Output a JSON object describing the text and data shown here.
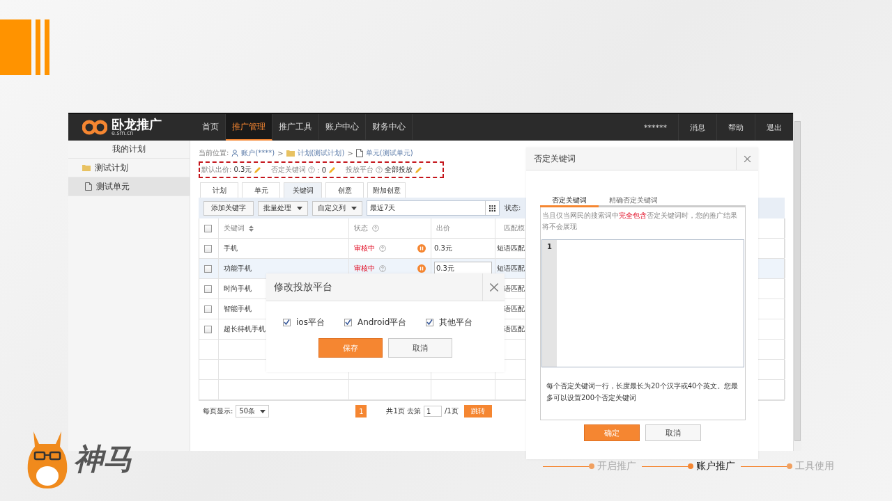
{
  "slide": {
    "steps": [
      {
        "label": "开启推广",
        "selected": false
      },
      {
        "label": "账户推广",
        "selected": true
      },
      {
        "label": "工具使用",
        "selected": false
      }
    ],
    "brand": "神马"
  },
  "app": {
    "logo": "卧龙推广",
    "logo_sub": "e.sm.cn",
    "nav": [
      {
        "label": "首页",
        "selected": false
      },
      {
        "label": "推广管理",
        "selected": true
      },
      {
        "label": "推广工具",
        "selected": false
      },
      {
        "label": "账户中心",
        "selected": false
      },
      {
        "label": "财务中心",
        "selected": false
      }
    ],
    "user": "******",
    "links": [
      "消息",
      "帮助",
      "退出"
    ]
  },
  "sidebar": {
    "title": "我的计划",
    "items": [
      {
        "label": "测试计划",
        "kind": "folder",
        "selected": false,
        "children": [
          {
            "label": "测试单元",
            "kind": "file",
            "selected": true
          }
        ]
      }
    ]
  },
  "breadcrumb": {
    "label": "当前位置:",
    "items": [
      {
        "label": "账户(****)",
        "kind": "user"
      },
      {
        "label": "计划(测试计划)",
        "kind": "folder"
      },
      {
        "label": "单元(测试单元)",
        "kind": "file"
      }
    ],
    "separator": ">"
  },
  "settings": [
    {
      "label": "默认出价:",
      "help": false,
      "value": "0.3元"
    },
    {
      "label": "否定关键词",
      "help": true,
      "suffix": ":",
      "value": "0"
    },
    {
      "label": "投放平台",
      "help": true,
      "value": "全部投放"
    }
  ],
  "tabs": [
    {
      "label": "计划",
      "selected": false
    },
    {
      "label": "单元",
      "selected": false
    },
    {
      "label": "关键词",
      "selected": true
    },
    {
      "label": "创意",
      "selected": false
    },
    {
      "label": "附加创意",
      "selected": false
    }
  ],
  "toolbar": {
    "buttons": [
      {
        "label": "添加关键字",
        "kind": "button"
      },
      {
        "label": "批量处理",
        "kind": "dropdown"
      },
      {
        "label": "自定义列",
        "kind": "dropdown"
      }
    ],
    "date": "最近7天",
    "status_label": "状态:"
  },
  "table": {
    "columns": [
      {
        "label": "关键词",
        "kind": "sort"
      },
      {
        "label": "状态",
        "kind": "help"
      },
      {
        "label": "出价",
        "kind": "plain"
      },
      {
        "label": "匹配模",
        "kind": "plain"
      }
    ],
    "select_all": false,
    "rows": [
      {
        "checked": false,
        "highlighted": false,
        "keyword": "手机",
        "status": "审核中",
        "paused": true,
        "bid": "0.3元",
        "editing": false,
        "match": "短语匹配"
      },
      {
        "checked": false,
        "highlighted": true,
        "keyword": "功能手机",
        "status": "审核中",
        "paused": true,
        "bid": "0.3元",
        "editing": true,
        "match": "短语匹配"
      },
      {
        "checked": false,
        "highlighted": false,
        "keyword": "时尚手机",
        "match": "语匹配"
      },
      {
        "checked": false,
        "highlighted": false,
        "keyword": "智能手机",
        "match": "语匹配"
      },
      {
        "checked": false,
        "highlighted": false,
        "keyword": "超长待机手机",
        "match": "语匹配"
      }
    ]
  },
  "pagination": {
    "per_page_label": "每页显示:",
    "per_page": "50条",
    "pages": [
      {
        "label": "1",
        "selected": true
      }
    ],
    "total": "共1页 去第",
    "goto": "1",
    "of": "/1页",
    "go": "跳转"
  },
  "platform_dialog": {
    "title": "修改投放平台",
    "options": [
      {
        "label": "ios平台",
        "checked": true
      },
      {
        "label": "Android平台",
        "checked": true
      },
      {
        "label": "其他平台",
        "checked": true
      }
    ],
    "buttons": [
      {
        "label": "保存",
        "kind": "primary"
      },
      {
        "label": "取消",
        "kind": "secondary"
      }
    ]
  },
  "negative_dialog": {
    "title": "否定关键词",
    "tabs": [
      {
        "label": "否定关键词",
        "selected": true
      },
      {
        "label": "精确否定关键词",
        "selected": false
      }
    ],
    "hint": {
      "before": "当且仅当网民的搜索词中",
      "highlight": "完全包含",
      "after": "否定关键词时，您的推广结果将不会展现"
    },
    "line_numbers": [
      "1"
    ],
    "note": "每个否定关键词一行，长度最长为20个汉字或40个英文。您最多可以设置200个否定关键词",
    "buttons": [
      {
        "label": "确定",
        "kind": "primary"
      },
      {
        "label": "取消",
        "kind": "secondary"
      }
    ]
  }
}
